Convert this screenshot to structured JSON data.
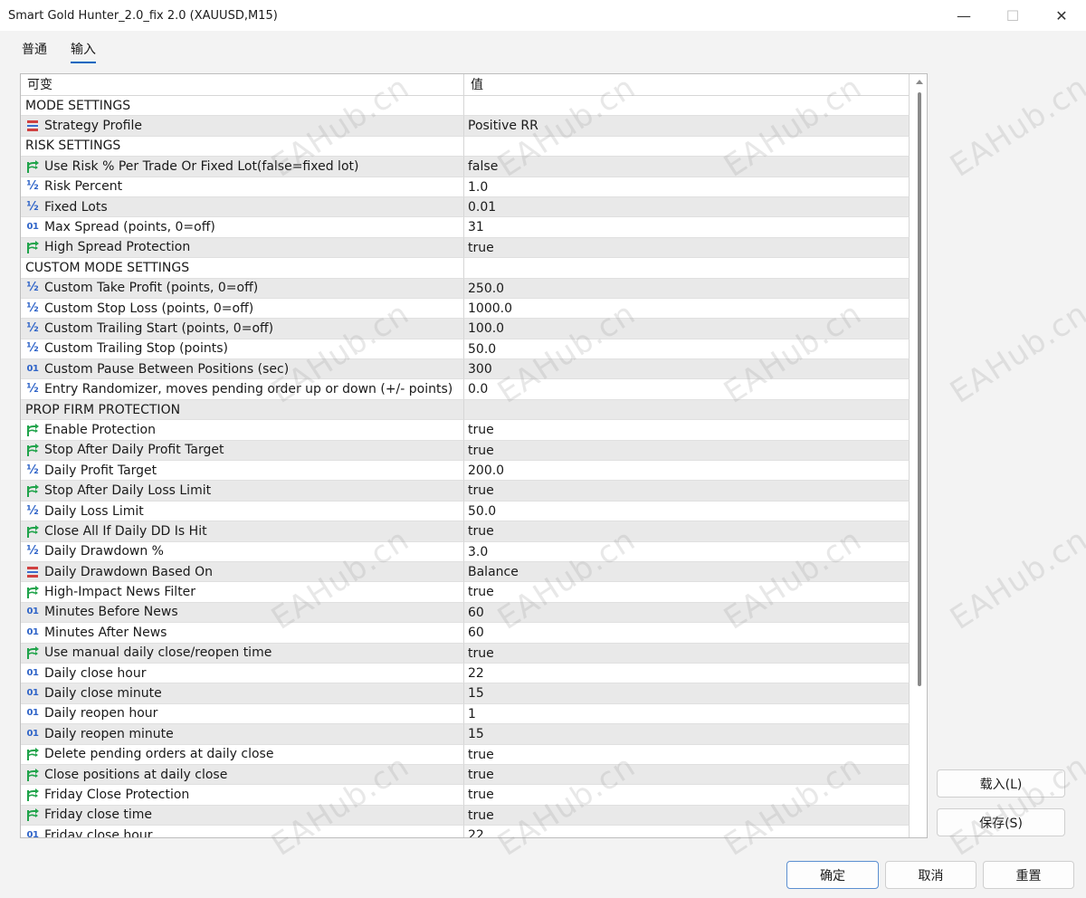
{
  "window": {
    "title": "Smart Gold Hunter_2.0_fix 2.0 (XAUUSD,M15)",
    "minimize": "—",
    "maximize": "☐",
    "close": "✕"
  },
  "tabs": [
    {
      "label": "普通",
      "active": false
    },
    {
      "label": "输入",
      "active": true
    }
  ],
  "table": {
    "headers": [
      "可变",
      "值"
    ],
    "rows": [
      {
        "type": "section",
        "name": "MODE SETTINGS",
        "value": ""
      },
      {
        "type": "enum",
        "name": "Strategy Profile",
        "value": "Positive RR"
      },
      {
        "type": "section",
        "name": "RISK SETTINGS",
        "value": ""
      },
      {
        "type": "bool",
        "name": "Use Risk % Per Trade Or Fixed Lot(false=fixed lot)",
        "value": "false"
      },
      {
        "type": "double",
        "name": "Risk Percent",
        "value": "1.0"
      },
      {
        "type": "double",
        "name": "Fixed Lots",
        "value": "0.01"
      },
      {
        "type": "int",
        "name": "Max Spread (points, 0=off)",
        "value": "31"
      },
      {
        "type": "bool",
        "name": "High Spread Protection",
        "value": "true"
      },
      {
        "type": "section",
        "name": "CUSTOM MODE SETTINGS",
        "value": ""
      },
      {
        "type": "double",
        "name": "Custom Take Profit (points, 0=off)",
        "value": "250.0"
      },
      {
        "type": "double",
        "name": "Custom Stop Loss (points, 0=off)",
        "value": "1000.0"
      },
      {
        "type": "double",
        "name": "Custom Trailing Start (points, 0=off)",
        "value": "100.0"
      },
      {
        "type": "double",
        "name": "Custom Trailing Stop (points)",
        "value": "50.0"
      },
      {
        "type": "int",
        "name": "Custom Pause Between Positions (sec)",
        "value": "300"
      },
      {
        "type": "double",
        "name": "Entry Randomizer, moves pending order up or down (+/- points)",
        "value": "0.0"
      },
      {
        "type": "section",
        "name": "PROP FIRM PROTECTION",
        "value": ""
      },
      {
        "type": "bool",
        "name": "Enable Protection",
        "value": "true"
      },
      {
        "type": "bool",
        "name": "Stop After Daily Profit Target",
        "value": "true"
      },
      {
        "type": "double",
        "name": "Daily Profit Target",
        "value": "200.0"
      },
      {
        "type": "bool",
        "name": "Stop After Daily Loss Limit",
        "value": "true"
      },
      {
        "type": "double",
        "name": "Daily Loss Limit",
        "value": "50.0"
      },
      {
        "type": "bool",
        "name": "Close All If Daily DD Is Hit",
        "value": "true"
      },
      {
        "type": "double",
        "name": "Daily Drawdown %",
        "value": "3.0"
      },
      {
        "type": "enum",
        "name": "Daily Drawdown Based On",
        "value": "Balance"
      },
      {
        "type": "bool",
        "name": "High-Impact News Filter",
        "value": "true"
      },
      {
        "type": "int",
        "name": "Minutes Before News",
        "value": "60"
      },
      {
        "type": "int",
        "name": "Minutes After News",
        "value": "60"
      },
      {
        "type": "bool",
        "name": "Use manual daily close/reopen time",
        "value": "true"
      },
      {
        "type": "int",
        "name": "Daily close hour",
        "value": "22"
      },
      {
        "type": "int",
        "name": "Daily close minute",
        "value": "15"
      },
      {
        "type": "int",
        "name": "Daily reopen hour",
        "value": "1"
      },
      {
        "type": "int",
        "name": "Daily reopen minute",
        "value": "15"
      },
      {
        "type": "bool",
        "name": "Delete pending orders at daily close",
        "value": "true"
      },
      {
        "type": "bool",
        "name": "Close positions at daily close",
        "value": "true"
      },
      {
        "type": "bool",
        "name": "Friday Close Protection",
        "value": "true"
      },
      {
        "type": "bool",
        "name": "Friday close time",
        "value": "true"
      },
      {
        "type": "int",
        "name": "Friday close hour",
        "value": "22"
      }
    ]
  },
  "icons": {
    "bool": "branch-arrow-icon",
    "double": "fraction-icon",
    "int": "integer-icon",
    "enum": "enum-list-icon"
  },
  "colors": {
    "bool_icon": "#1fa34a",
    "number_icon": "#2f64c8",
    "enum_icon_a": "#d04040",
    "enum_icon_b": "#3a6fd0",
    "primary_border": "#5b8fd1"
  },
  "buttons": {
    "load": "载入(L)",
    "save": "保存(S)",
    "ok": "确定",
    "cancel": "取消",
    "reset": "重置"
  },
  "watermark": "EAHub.cn"
}
